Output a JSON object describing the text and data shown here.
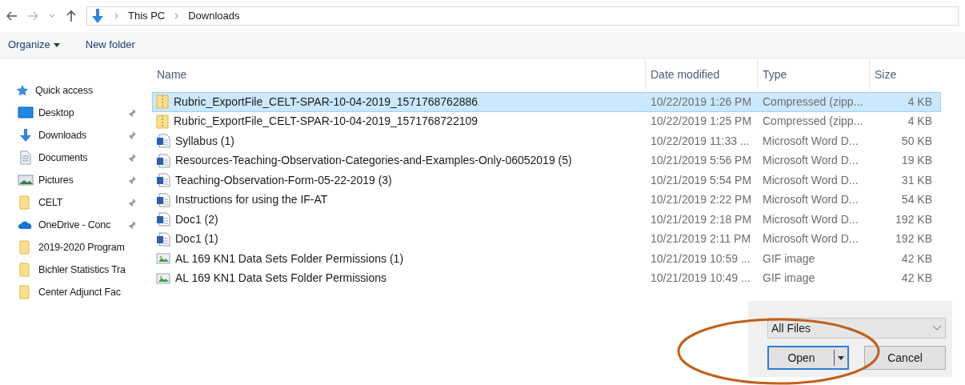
{
  "address_bar": {
    "breadcrumbs": [
      "This PC",
      "Downloads"
    ]
  },
  "toolbar": {
    "organize": "Organize",
    "new_folder": "New folder"
  },
  "sidebar": {
    "items": [
      {
        "label": "Quick access",
        "kind": "quick",
        "pinned": false
      },
      {
        "label": "Desktop",
        "kind": "desktop",
        "pinned": true
      },
      {
        "label": "Downloads",
        "kind": "downloads",
        "pinned": true
      },
      {
        "label": "Documents",
        "kind": "documents",
        "pinned": true
      },
      {
        "label": "Pictures",
        "kind": "pictures",
        "pinned": true
      },
      {
        "label": "CELT",
        "kind": "folder",
        "pinned": true
      },
      {
        "label": "OneDrive - Conc",
        "kind": "cloud",
        "pinned": true
      },
      {
        "label": "2019-2020 Program",
        "kind": "folder",
        "pinned": false
      },
      {
        "label": "Bichler Statistics Tra",
        "kind": "folder",
        "pinned": false
      },
      {
        "label": "Center Adjunct Fac",
        "kind": "folder",
        "pinned": false
      }
    ]
  },
  "table": {
    "columns": [
      "Name",
      "Date modified",
      "Type",
      "Size"
    ],
    "rows": [
      {
        "name": "Rubric_ExportFile_CELT-SPAR-10-04-2019_1571768762886",
        "date": "10/22/2019 1:26 PM",
        "type": "Compressed (zipp...",
        "size": "4 KB",
        "kind": "zip",
        "selected": true
      },
      {
        "name": "Rubric_ExportFile_CELT-SPAR-10-04-2019_1571768722109",
        "date": "10/22/2019 1:25 PM",
        "type": "Compressed (zipp...",
        "size": "4 KB",
        "kind": "zip",
        "selected": false
      },
      {
        "name": "Syllabus (1)",
        "date": "10/22/2019 11:33 ...",
        "type": "Microsoft Word D...",
        "size": "50 KB",
        "kind": "word",
        "selected": false
      },
      {
        "name": "Resources-Teaching-Observation-Categories-and-Examples-Only-06052019 (5)",
        "date": "10/21/2019 5:56 PM",
        "type": "Microsoft Word D...",
        "size": "19 KB",
        "kind": "word",
        "selected": false
      },
      {
        "name": "Teaching-Observation-Form-05-22-2019 (3)",
        "date": "10/21/2019 5:54 PM",
        "type": "Microsoft Word D...",
        "size": "31 KB",
        "kind": "word",
        "selected": false
      },
      {
        "name": "Instructions for using the IF-AT",
        "date": "10/21/2019 2:22 PM",
        "type": "Microsoft Word D...",
        "size": "54 KB",
        "kind": "word",
        "selected": false
      },
      {
        "name": "Doc1 (2)",
        "date": "10/21/2019 2:18 PM",
        "type": "Microsoft Word D...",
        "size": "192 KB",
        "kind": "word",
        "selected": false
      },
      {
        "name": "Doc1 (1)",
        "date": "10/21/2019 2:11 PM",
        "type": "Microsoft Word D...",
        "size": "192 KB",
        "kind": "word",
        "selected": false
      },
      {
        "name": "AL 169 KN1 Data Sets Folder Permissions (1)",
        "date": "10/21/2019 10:59 ...",
        "type": "GIF image",
        "size": "42 KB",
        "kind": "gif",
        "selected": false
      },
      {
        "name": "AL 169 KN1 Data Sets Folder Permissions",
        "date": "10/21/2019 10:49 ...",
        "type": "GIF image",
        "size": "42 KB",
        "kind": "gif",
        "selected": false
      }
    ]
  },
  "footer": {
    "filter": "All Files",
    "open": "Open",
    "cancel": "Cancel"
  }
}
